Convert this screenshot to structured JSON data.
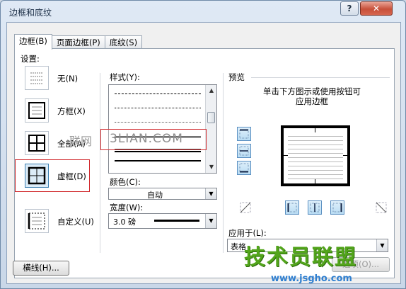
{
  "window": {
    "title": "边框和底纹",
    "help_label": "?",
    "close_label": "✕"
  },
  "tabs": [
    {
      "label": "边框(B)",
      "active": true
    },
    {
      "label": "页面边框(P)",
      "active": false
    },
    {
      "label": "底纹(S)",
      "active": false
    }
  ],
  "settings": {
    "group_label": "设置:",
    "items": [
      {
        "label": "无(N)",
        "icon": "no-border-icon"
      },
      {
        "label": "方框(X)",
        "icon": "box-border-icon"
      },
      {
        "label": "全部(A)",
        "icon": "all-borders-icon"
      },
      {
        "label": "虚框(D)",
        "icon": "grid-border-icon",
        "selected": true
      },
      {
        "label": "自定义(U)",
        "icon": "custom-border-icon"
      }
    ]
  },
  "style": {
    "label": "样式(Y):"
  },
  "color": {
    "label": "颜色(C):",
    "value": "自动"
  },
  "width": {
    "label": "宽度(W):",
    "value": "3.0 磅"
  },
  "preview": {
    "label": "预览",
    "instruction_line1": "单击下方图示或使用按钮可",
    "instruction_line2": "应用边框"
  },
  "apply_to": {
    "label": "应用于(L):",
    "value": "表格"
  },
  "buttons": {
    "options": "选项(O)...",
    "horizontal_line": "横线(H)..."
  },
  "watermarks": {
    "overlay_cn": "联网",
    "overlay_en": "3LIAN.COM",
    "logo": "技术员联盟",
    "site": "www.jsgho.com"
  },
  "colors": {
    "title_bar": "#dfe9f5",
    "selected_outline": "#d0262a",
    "logo_green": "#53a51c"
  }
}
